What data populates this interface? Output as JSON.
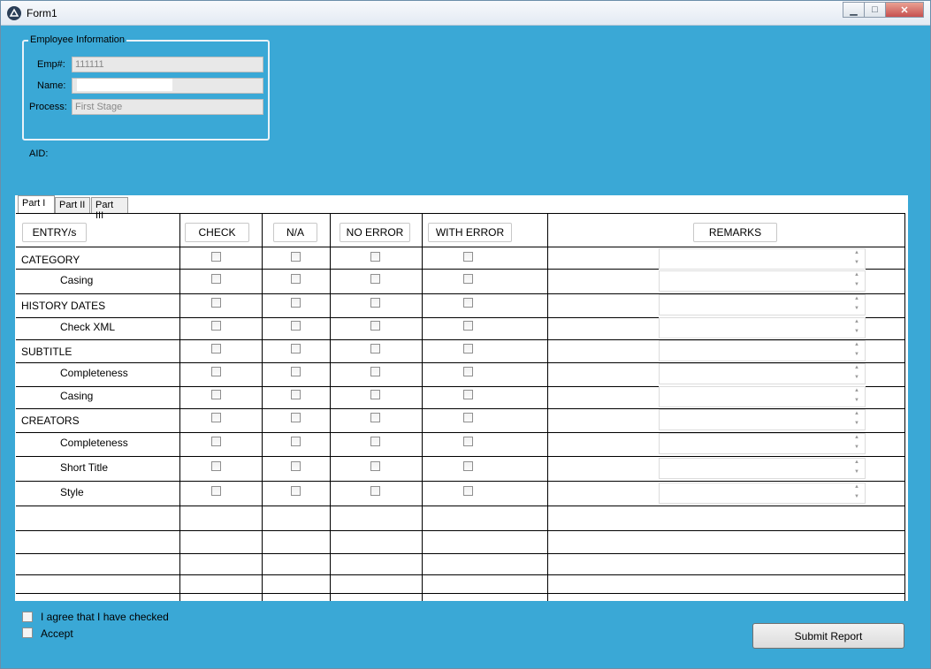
{
  "window": {
    "title": "Form1"
  },
  "employee": {
    "legend": "Employee Information",
    "emp_label": "Emp#:",
    "emp_value": "111111",
    "name_label": "Name:",
    "name_value": "",
    "process_label": "Process:",
    "process_value": "First Stage"
  },
  "aid_label": "AID:",
  "tabs": [
    "Part I",
    "Part II",
    "Part III"
  ],
  "columns": {
    "entry": "ENTRY/s",
    "check": "CHECK",
    "na": "N/A",
    "no_error": "NO ERROR",
    "with_error": "WITH ERROR",
    "remarks": "REMARKS"
  },
  "rows": [
    {
      "label": "CATEGORY",
      "indent": false
    },
    {
      "label": "Casing",
      "indent": true
    },
    {
      "label": "HISTORY DATES",
      "indent": false
    },
    {
      "label": "Check XML",
      "indent": true
    },
    {
      "label": "SUBTITLE",
      "indent": false
    },
    {
      "label": "Completeness",
      "indent": true
    },
    {
      "label": "Casing",
      "indent": true
    },
    {
      "label": "CREATORS",
      "indent": false
    },
    {
      "label": "Completeness",
      "indent": true
    },
    {
      "label": "Short Title",
      "indent": true
    },
    {
      "label": "Style",
      "indent": true
    }
  ],
  "agree_label": "I agree that I have checked",
  "accept_label": "Accept",
  "submit_label": "Submit Report"
}
